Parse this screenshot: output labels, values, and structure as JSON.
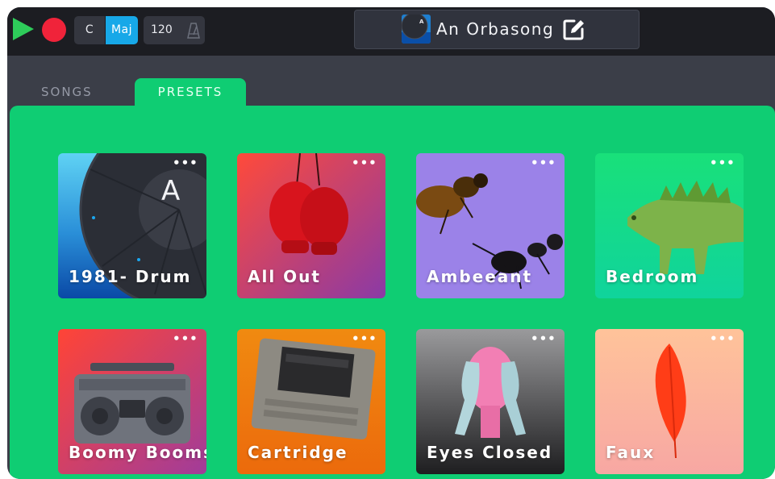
{
  "toolbar": {
    "play_icon": "play-icon",
    "record_icon": "record-icon",
    "key_note": "C",
    "key_scale": "Maj",
    "tempo": "120",
    "metronome_icon": "metronome-icon",
    "song_title": "An Orbasong",
    "edit_icon": "edit-icon"
  },
  "tabs": [
    {
      "label": "SONGS",
      "active": false
    },
    {
      "label": "PRESETS",
      "active": true
    }
  ],
  "presets": [
    {
      "label": "1981- Drum",
      "menu": "•••",
      "image": "orba-device-image"
    },
    {
      "label": "All Out",
      "menu": "•••",
      "image": "boxing-gloves-image"
    },
    {
      "label": "Ambeeant",
      "menu": "•••",
      "image": "bee-and-ant-image"
    },
    {
      "label": "Bedroom",
      "menu": "•••",
      "image": "toy-dinosaur-image"
    },
    {
      "label": "Boomy Booms",
      "menu": "•••",
      "image": "boombox-image"
    },
    {
      "label": "Cartridge",
      "menu": "•••",
      "image": "game-cartridge-image"
    },
    {
      "label": "Eyes Closed",
      "menu": "•••",
      "image": "covered-eyes-head-image"
    },
    {
      "label": "Faux",
      "menu": "•••",
      "image": "feather-image"
    }
  ],
  "colors": {
    "panel": "#0fcd73",
    "toolbar": "#1c1d22",
    "accent_blue": "#17a8e8",
    "play_green": "#2ecc5a",
    "record_red": "#f0233a"
  }
}
